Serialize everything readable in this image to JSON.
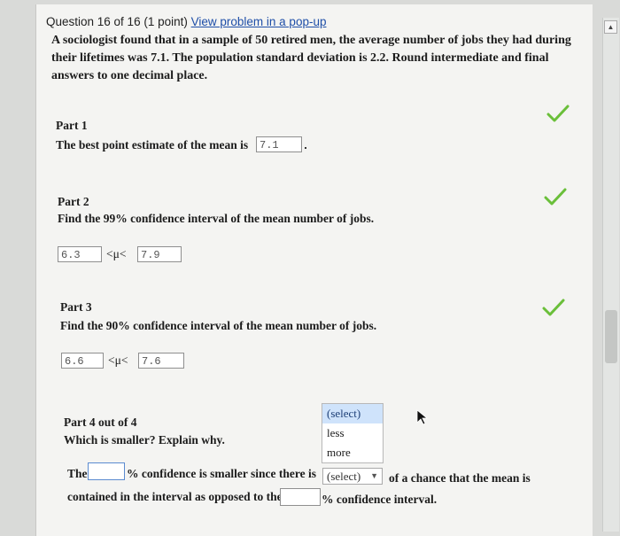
{
  "header": {
    "question_label": "Question 16 of 16 (1 point)",
    "popup_link": "View problem in a pop-up"
  },
  "problem": {
    "text": "A sociologist found that in a sample of 50 retired men, the average number of jobs they had during their lifetimes was 7.1. The population standard deviation is 2.2. Round intermediate and final answers to one decimal place."
  },
  "part1": {
    "title": "Part 1",
    "prompt": "The best point estimate of the mean is",
    "answer": "7.1",
    "status": "correct"
  },
  "part2": {
    "title": "Part 2",
    "prompt": "Find the 99% confidence interval of the mean number of jobs.",
    "lower": "6.3",
    "upper": "7.9",
    "relation": "<μ<",
    "status": "correct"
  },
  "part3": {
    "title": "Part 3",
    "prompt": "Find the 90% confidence interval of the mean number of jobs.",
    "lower": "6.6",
    "upper": "7.6",
    "relation": "<μ<",
    "status": "correct"
  },
  "part4": {
    "title": "Part 4 out of 4",
    "prompt": "Which is smaller? Explain why.",
    "sentence_start": "The",
    "sentence_mid": "% confidence is smaller since there is",
    "sentence_after_select": "of a chance that the mean is",
    "sentence_line2": "contained in the interval as opposed to the",
    "sentence_end": "% confidence interval.",
    "first_percent_value": "",
    "second_percent_value": "",
    "dropdown_options": [
      "(select)",
      "less",
      "more"
    ],
    "dropdown_selected": "(select)"
  },
  "colors": {
    "check": "#6abf3a",
    "link": "#1f4fa8",
    "dropdown_highlight": "#cfe3fb"
  }
}
